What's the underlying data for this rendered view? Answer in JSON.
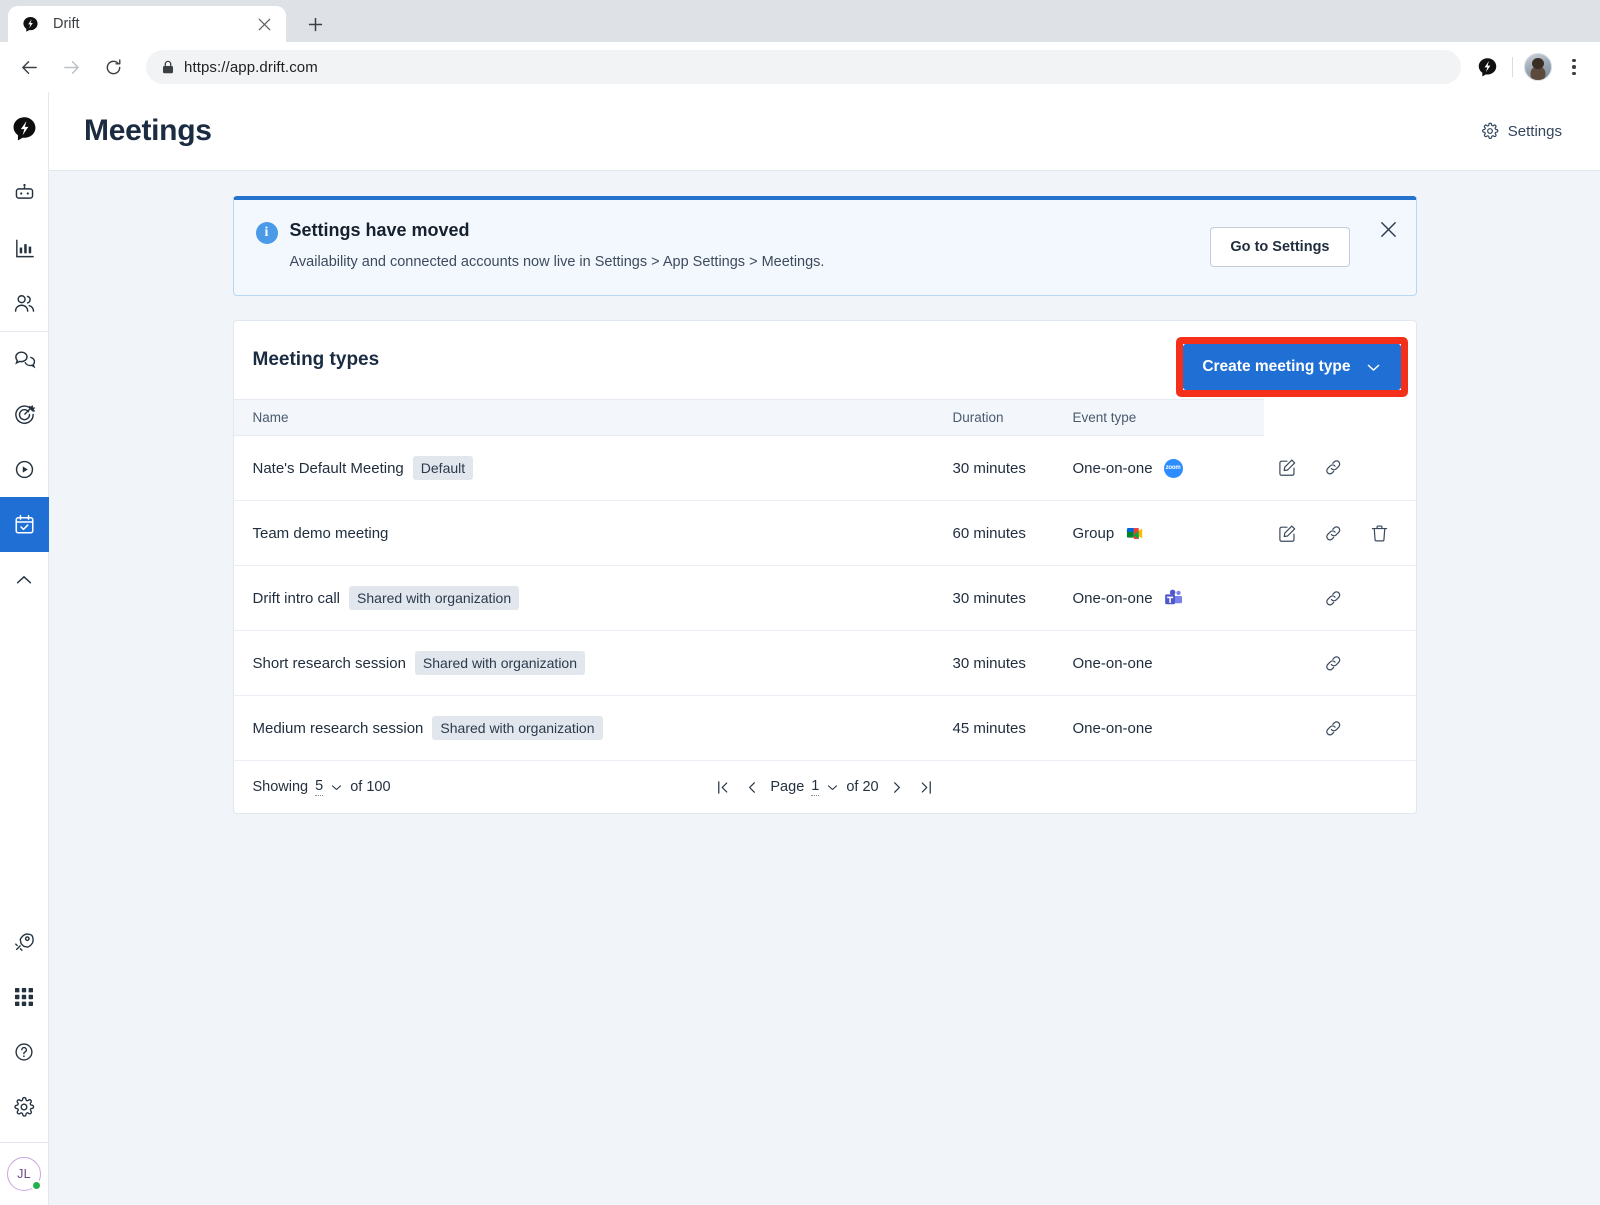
{
  "browser": {
    "tab_title": "Drift",
    "tab_favicon_name": "drift-bolt-favicon",
    "url": "https://app.drift.com",
    "new_tab_label": "+",
    "close_tab_label": "×"
  },
  "sidebar": {
    "logo_name": "drift-logo",
    "items": [
      {
        "name": "bot-icon",
        "label": "Bots",
        "active": false
      },
      {
        "name": "chart-bar-icon",
        "label": "Reports",
        "active": false
      },
      {
        "name": "people-icon",
        "label": "Contacts",
        "active": false
      },
      {
        "name": "chat-bubbles-icon",
        "label": "Conversations",
        "active": false
      },
      {
        "name": "target-icon",
        "label": "Playbooks",
        "active": false
      },
      {
        "name": "play-circle-icon",
        "label": "Video",
        "active": false
      },
      {
        "name": "calendar-check-icon",
        "label": "Meetings",
        "active": true
      },
      {
        "name": "chevron-up-icon",
        "label": "Collapse",
        "active": false
      }
    ],
    "bottom_items": [
      {
        "name": "rocket-icon",
        "label": "What's new"
      },
      {
        "name": "apps-grid-icon",
        "label": "Apps"
      },
      {
        "name": "help-circle-icon",
        "label": "Help"
      },
      {
        "name": "gear-icon",
        "label": "Settings"
      }
    ],
    "user_initials": "JL",
    "presence": "online"
  },
  "header": {
    "title": "Meetings",
    "settings_label": "Settings",
    "settings_icon": "gear-icon"
  },
  "banner": {
    "icon": "info-icon",
    "title": "Settings have moved",
    "subtitle": "Availability and connected accounts now live in Settings > App Settings > Meetings.",
    "button_label": "Go to Settings",
    "close_icon": "close-icon",
    "accent_color": "#2573cd",
    "background_color": "#f3f8fe"
  },
  "card": {
    "title": "Meeting types",
    "create_button_label": "Create meeting type",
    "create_button_icon": "chevron-down-icon",
    "create_button_color": "#1f6fd4",
    "highlight_color": "#f4301a",
    "columns": [
      "Name",
      "Duration",
      "Event type",
      ""
    ],
    "rows": [
      {
        "name": "Nate's Default Meeting",
        "badge": "Default",
        "duration": "30 minutes",
        "event_type": "One-on-one",
        "provider": "zoom",
        "actions": [
          "edit-icon",
          "link-icon"
        ]
      },
      {
        "name": "Team demo meeting",
        "badge": "",
        "duration": "60 minutes",
        "event_type": "Group",
        "provider": "google-meet",
        "actions": [
          "edit-icon",
          "link-icon",
          "trash-icon"
        ]
      },
      {
        "name": "Drift intro call",
        "badge": "Shared with organization",
        "duration": "30 minutes",
        "event_type": "One-on-one",
        "provider": "microsoft-teams",
        "actions": [
          "link-icon"
        ]
      },
      {
        "name": "Short research session",
        "badge": "Shared with organization",
        "duration": "30 minutes",
        "event_type": "One-on-one",
        "provider": "",
        "actions": [
          "link-icon"
        ]
      },
      {
        "name": "Medium research session",
        "badge": "Shared with organization",
        "duration": "45 minutes",
        "event_type": "One-on-one",
        "provider": "",
        "actions": [
          "link-icon"
        ]
      }
    ],
    "footer": {
      "showing_prefix": "Showing",
      "showing_count": "5",
      "showing_suffix": "of 100",
      "page_prefix": "Page",
      "page_number": "1",
      "page_suffix": "of 20",
      "first_page_icon": "first-page-icon",
      "prev_page_icon": "chevron-left-icon",
      "next_page_icon": "chevron-right-icon",
      "last_page_icon": "last-page-icon",
      "dropdown_icon": "chevron-down-icon"
    }
  }
}
